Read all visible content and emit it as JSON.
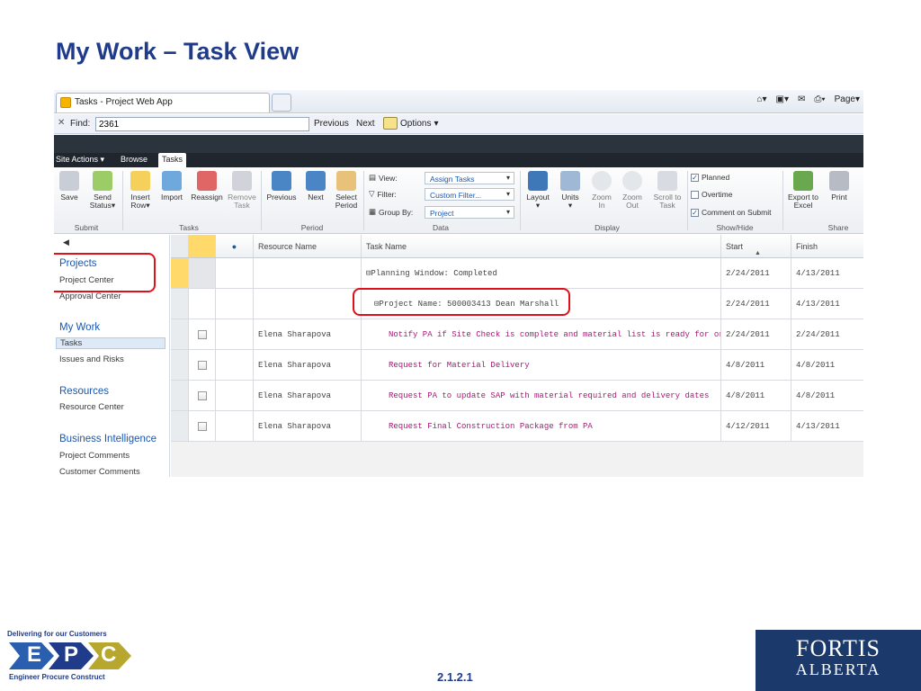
{
  "slide": {
    "title": "My Work – Task View",
    "page_number": "2.1.2.1"
  },
  "browser": {
    "tab_title": "Tasks - Project Web App",
    "command_bar": {
      "page_label": "Page"
    },
    "find": {
      "label": "Find:",
      "value": "2361",
      "previous_label": "Previous",
      "next_label": "Next",
      "options_label": "Options"
    }
  },
  "ribbon": {
    "tabs": [
      "Site Actions",
      "Browse",
      "Tasks"
    ],
    "active_tab": "Tasks",
    "buttons": {
      "save": "Save",
      "send_status_1": "Send",
      "send_status_2": "Status",
      "insert_row_1": "Insert",
      "insert_row_2": "Row",
      "import": "Import",
      "reassign": "Reassign",
      "remove_task_1": "Remove",
      "remove_task_2": "Task",
      "previous": "Previous",
      "next": "Next",
      "select_period_1": "Select",
      "select_period_2": "Period",
      "layout": "Layout",
      "units": "Units",
      "zoom_in_1": "Zoom",
      "zoom_in_2": "In",
      "zoom_out_1": "Zoom",
      "zoom_out_2": "Out",
      "scroll_to_task_1": "Scroll to",
      "scroll_to_task_2": "Task",
      "export_excel_1": "Export to",
      "export_excel_2": "Excel",
      "print": "Print"
    },
    "data_group": {
      "view_label": "View:",
      "view_value": "Assign Tasks",
      "filter_label": "Filter:",
      "filter_value": "Custom Filter...",
      "group_by_label": "Group By:",
      "group_by_value": "Project"
    },
    "show_hide": {
      "planned": "Planned",
      "overtime": "Overtime",
      "comment_on_submit": "Comment on Submit"
    },
    "groups": {
      "submit": "Submit",
      "tasks": "Tasks",
      "period": "Period",
      "data": "Data",
      "display": "Display",
      "show_hide": "Show/Hide",
      "share": "Share"
    }
  },
  "leftnav": {
    "projects_heading": "Projects",
    "project_center": "Project Center",
    "approval_center": "Approval Center",
    "mywork_heading": "My Work",
    "tasks": "Tasks",
    "issues_risks": "Issues and Risks",
    "resources_heading": "Resources",
    "resource_center": "Resource Center",
    "bi_heading": "Business Intelligence",
    "project_comments": "Project Comments",
    "customer_comments": "Customer Comments"
  },
  "grid": {
    "columns": [
      "Resource Name",
      "Task Name",
      "Start",
      "Finish"
    ],
    "group_rows": [
      {
        "label": "⊟Planning Window: Completed",
        "start": "2/24/2011",
        "finish": "4/13/2011"
      },
      {
        "label": "⊟Project Name: 500003413 Dean Marshall",
        "start": "2/24/2011",
        "finish": "4/13/2011"
      }
    ],
    "rows": [
      {
        "resource": "Elena Sharapova",
        "task": "Notify PA if Site Check is complete and material list is ready for order update",
        "start": "2/24/2011",
        "finish": "2/24/2011"
      },
      {
        "resource": "Elena Sharapova",
        "task": "Request for Material Delivery",
        "start": "4/8/2011",
        "finish": "4/8/2011"
      },
      {
        "resource": "Elena Sharapova",
        "task": "Request PA to update SAP with material required and delivery dates",
        "start": "4/8/2011",
        "finish": "4/8/2011"
      },
      {
        "resource": "Elena Sharapova",
        "task": "Request Final Construction Package from PA",
        "start": "4/12/2011",
        "finish": "4/13/2011"
      }
    ]
  },
  "logos": {
    "epc_tagline_top": "Delivering for our Customers",
    "epc_letters": "EPC",
    "epc_tagline_bottom": "Engineer  Procure  Construct",
    "fortis_line1": "FORTIS",
    "fortis_line2": "ALBERTA"
  },
  "colors": {
    "title": "#1f3b8a",
    "task_text": "#b0147a",
    "highlight": "#e0101a",
    "link": "#1a57b0"
  }
}
